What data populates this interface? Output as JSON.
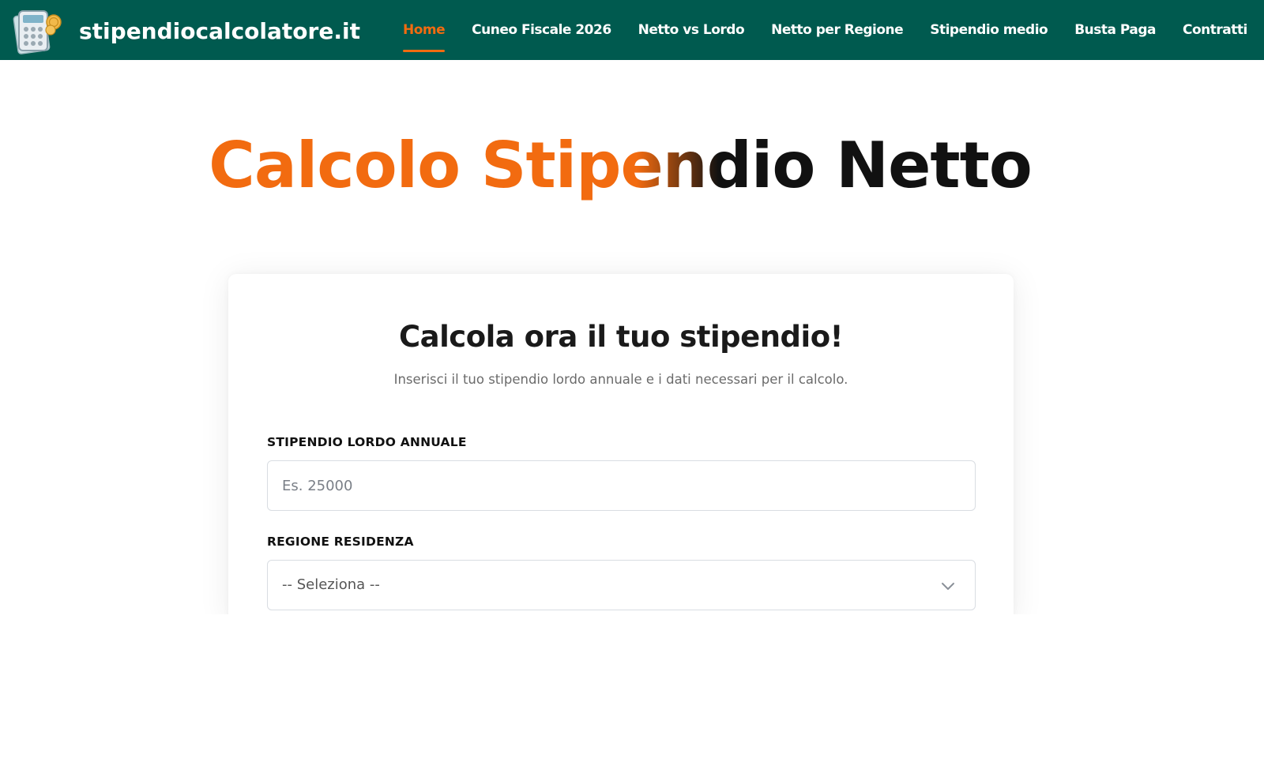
{
  "header": {
    "brand_name": "stipendiocalcolatore.it",
    "logo_icon": "calculator-money-icon",
    "background_color": "#005a4f",
    "accent_color": "#f26b10",
    "nav": [
      {
        "label": "Home",
        "active": true
      },
      {
        "label": "Cuneo Fiscale 2026",
        "active": false
      },
      {
        "label": "Netto vs Lordo",
        "active": false
      },
      {
        "label": "Netto per Regione",
        "active": false
      },
      {
        "label": "Stipendio medio",
        "active": false
      },
      {
        "label": "Busta Paga",
        "active": false
      },
      {
        "label": "Contratti",
        "active": false
      }
    ]
  },
  "hero": {
    "title": "Calcolo Stipendio Netto"
  },
  "calculator": {
    "title": "Calcola ora il tuo stipendio!",
    "subtitle": "Inserisci il tuo stipendio lordo annuale e i dati necessari per il calcolo.",
    "salary": {
      "label": "STIPENDIO LORDO ANNUALE",
      "value": "",
      "placeholder": "Es. 25000"
    },
    "region": {
      "label": "REGIONE RESIDENZA",
      "selected": "-- Seleziona --",
      "icon": "chevron-down-icon"
    }
  }
}
